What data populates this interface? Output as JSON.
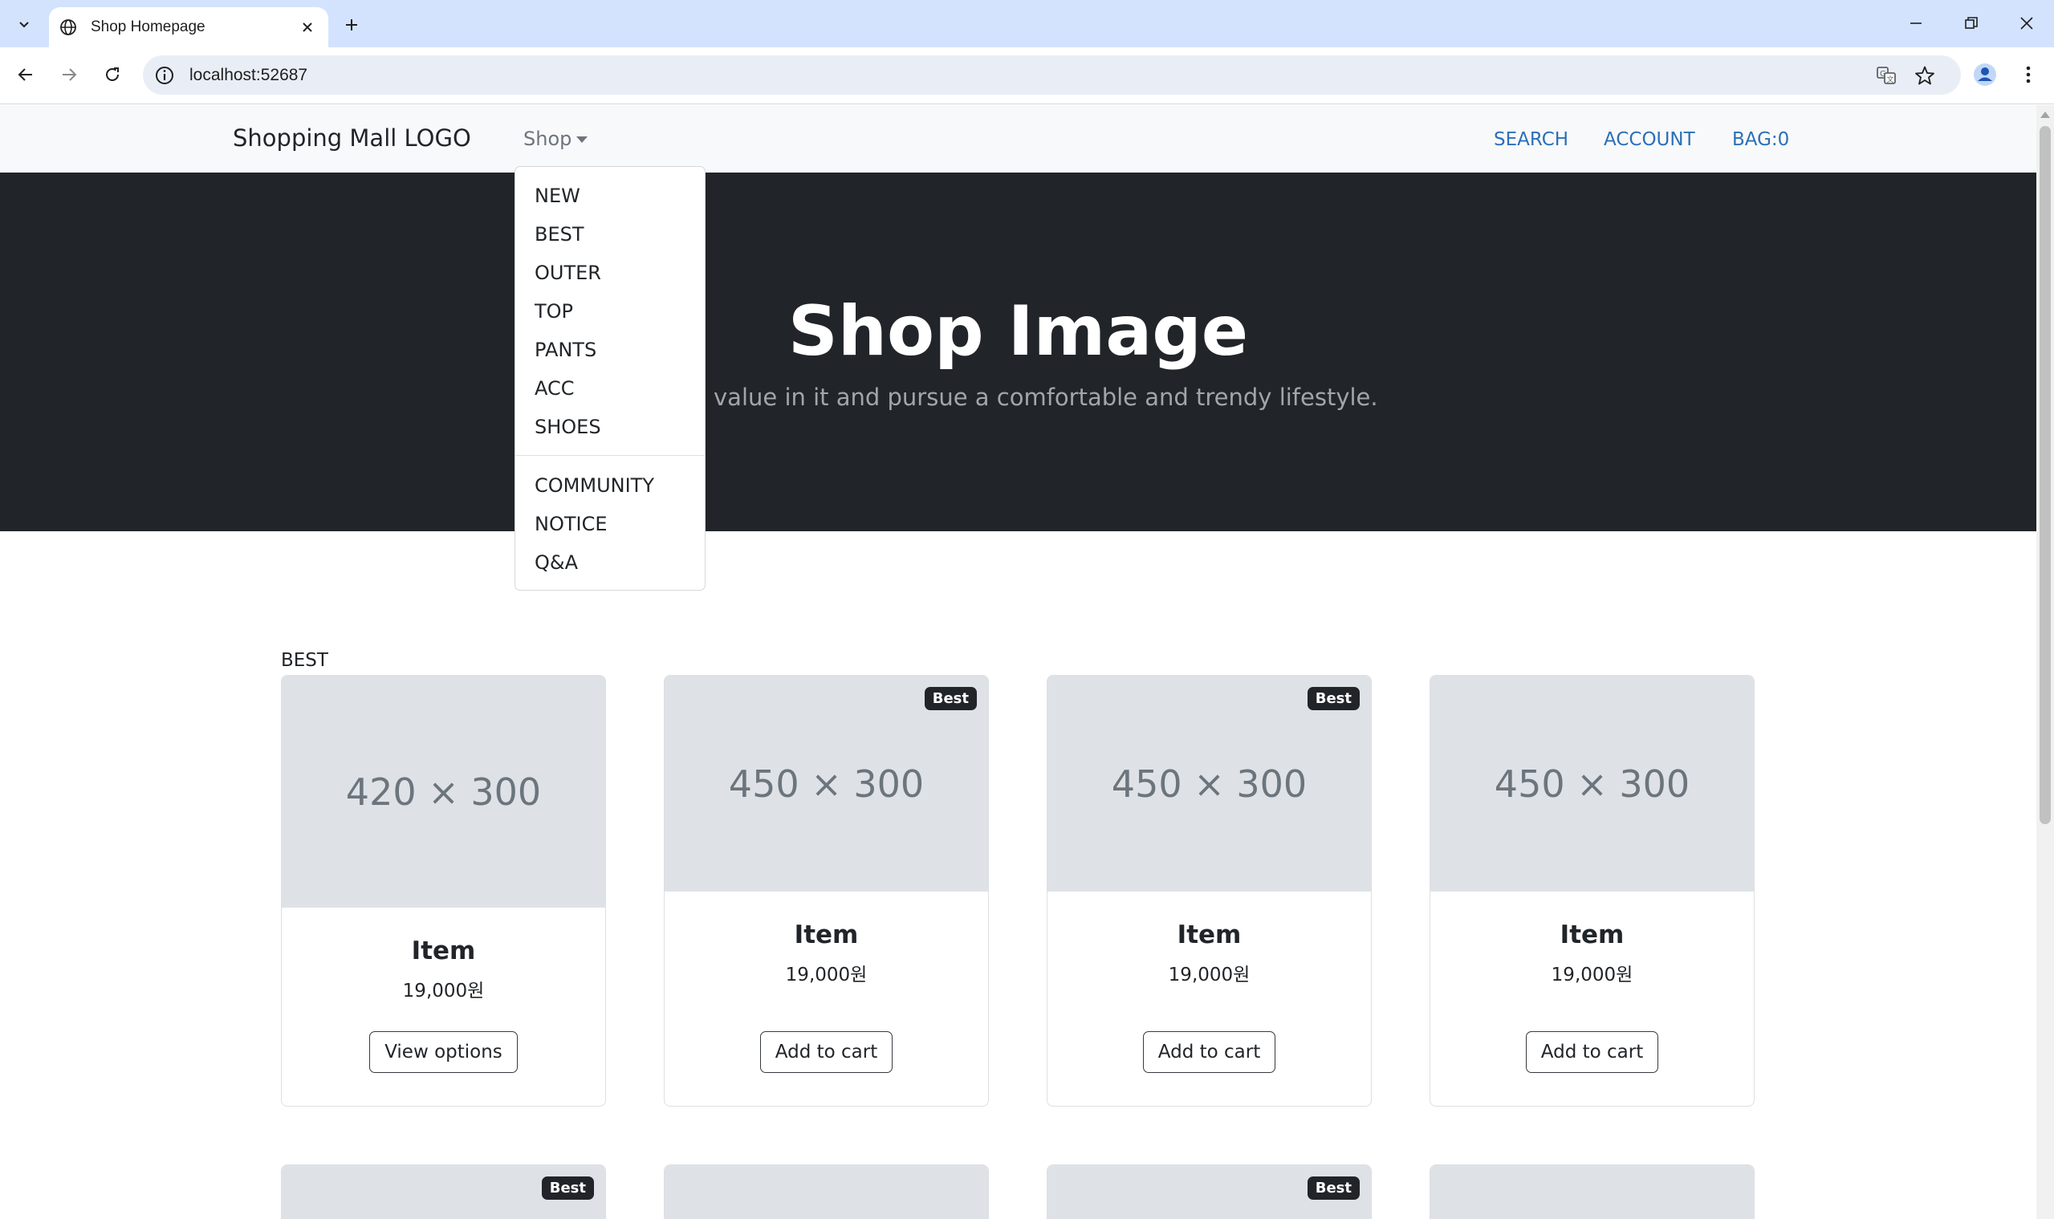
{
  "browser": {
    "tab_title": "Shop Homepage",
    "url": "localhost:52687"
  },
  "navbar": {
    "brand": "Shopping Mall LOGO",
    "shop_label": "Shop",
    "search_label": "SEARCH",
    "account_label": "ACCOUNT",
    "bag_label": "BAG:0"
  },
  "dropdown": {
    "items": [
      "NEW",
      "BEST",
      "OUTER",
      "TOP",
      "PANTS",
      "ACC",
      "SHOES"
    ],
    "extra_items": [
      "COMMUNITY",
      "NOTICE",
      "Q&A"
    ]
  },
  "hero": {
    "title": "Shop Image",
    "subtitle": "Find value in it and pursue a comfortable and trendy lifestyle."
  },
  "section": {
    "label": "BEST"
  },
  "products": [
    {
      "image_label": "420 × 300",
      "name": "Item",
      "price": "19,000원",
      "button": "View options",
      "badge": ""
    },
    {
      "image_label": "450 × 300",
      "name": "Item",
      "price": "19,000원",
      "button": "Add to cart",
      "badge": "Best"
    },
    {
      "image_label": "450 × 300",
      "name": "Item",
      "price": "19,000원",
      "button": "Add to cart",
      "badge": "Best"
    },
    {
      "image_label": "450 × 300",
      "name": "Item",
      "price": "19,000원",
      "button": "Add to cart",
      "badge": ""
    }
  ],
  "products_row2": [
    {
      "badge": "Best"
    },
    {
      "badge": ""
    },
    {
      "badge": "Best"
    },
    {
      "badge": ""
    }
  ],
  "colors": {
    "chrome_tab_strip": "#d3e3fd",
    "hero_bg": "#212529",
    "nav_link": "#2b6fb9",
    "placeholder_bg": "#dee2e6",
    "badge_bg": "#212529"
  },
  "icons": {
    "tab_search": "chevron-down-icon",
    "tab_favicon": "globe-icon",
    "tab_close": "close-icon",
    "new_tab": "plus-icon",
    "back": "arrow-left-icon",
    "forward": "arrow-right-icon",
    "reload": "reload-icon",
    "site_info": "info-icon",
    "translate": "translate-icon",
    "bookmark": "star-icon",
    "profile": "person-icon",
    "menu": "kebab-menu-icon"
  }
}
